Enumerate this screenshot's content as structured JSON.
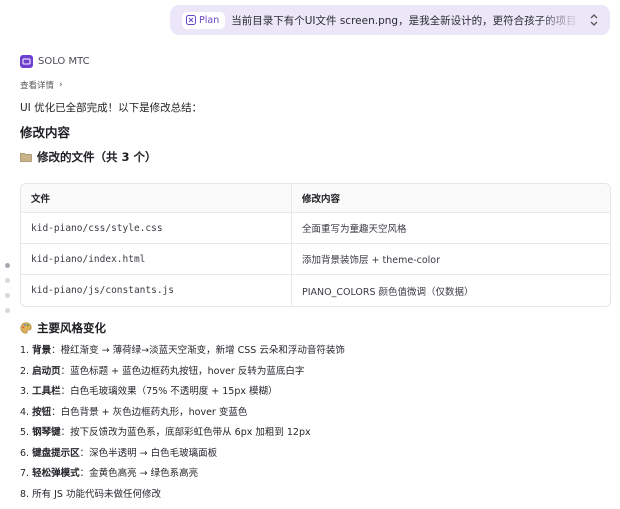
{
  "prompt": {
    "plan_label": "Plan",
    "text": "当前目录下有个UI文件 screen.png，是我全新设计的，更符合孩子的项目，有童趣。你"
  },
  "agent": {
    "name": "SOLO MTC",
    "details_link": "查看详情",
    "summary": "UI 优化已全部完成！以下是修改总结："
  },
  "section_title": "修改内容",
  "files_heading": "修改的文件（共 3 个）",
  "table": {
    "headers": [
      "文件",
      "修改内容"
    ],
    "rows": [
      {
        "file": "kid-piano/css/style.css",
        "change": "全面重写为童趣天空风格"
      },
      {
        "file": "kid-piano/index.html",
        "change": "添加背景装饰层 + theme-color"
      },
      {
        "file": "kid-piano/js/constants.js",
        "change": "PIANO_COLORS 颜色值微调（仅数据）"
      }
    ]
  },
  "style_heading": "主要风格变化",
  "changes": [
    {
      "num": "1.",
      "key": "背景",
      "text": "：橙红渐变 → 薄荷绿→淡蓝天空渐变，新增 CSS 云朵和浮动音符装饰"
    },
    {
      "num": "2.",
      "key": "启动页",
      "text": "：蓝色标题 + 蓝色边框药丸按钮，hover 反转为蓝底白字"
    },
    {
      "num": "3.",
      "key": "工具栏",
      "text": "：白色毛玻璃效果（75% 不透明度 + 15px 模糊）"
    },
    {
      "num": "4.",
      "key": "按钮",
      "text": "：白色背景 + 灰色边框药丸形，hover 变蓝色"
    },
    {
      "num": "5.",
      "key": "钢琴键",
      "text": "：按下反馈改为蓝色系，底部彩虹色带从 6px 加粗到 12px"
    },
    {
      "num": "6.",
      "key": "键盘提示区",
      "text": "：深色半透明 → 白色毛玻璃面板"
    },
    {
      "num": "7.",
      "key": "轻松弹模式",
      "text": "：金黄色高亮 → 绿色系高亮"
    },
    {
      "num": "8.",
      "key": "",
      "text": "所有 JS 功能代码未做任何修改"
    }
  ],
  "colors": {
    "prompt_bg": "#ece7f8",
    "accent_purple": "#6e3fd0"
  },
  "icons": [
    "plan-icon",
    "chevron-updown-icon",
    "agent-logo-icon",
    "chevron-right-icon",
    "folder-icon",
    "palette-icon"
  ]
}
